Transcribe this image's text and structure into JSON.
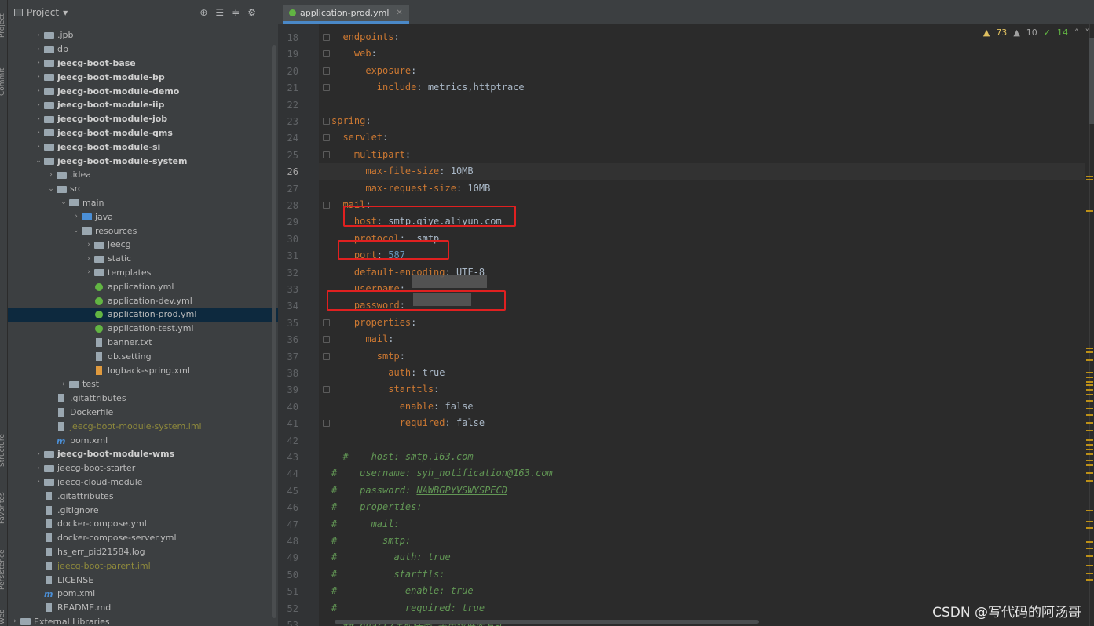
{
  "side_strip": {
    "project": "Project",
    "commit": "Commit",
    "structure": "Structure",
    "favorites": "Favorites",
    "persistence": "Persistence",
    "web": "Web"
  },
  "project_panel": {
    "title": "Project",
    "tree": [
      {
        "label": ".jpb",
        "depth": 1,
        "kind": "folder",
        "arrow": "right",
        "style": ""
      },
      {
        "label": "db",
        "depth": 1,
        "kind": "folder",
        "arrow": "right",
        "style": ""
      },
      {
        "label": "jeecg-boot-base",
        "depth": 1,
        "kind": "folder",
        "arrow": "right",
        "style": "bold"
      },
      {
        "label": "jeecg-boot-module-bp",
        "depth": 1,
        "kind": "folder",
        "arrow": "right",
        "style": "bold"
      },
      {
        "label": "jeecg-boot-module-demo",
        "depth": 1,
        "kind": "folder",
        "arrow": "right",
        "style": "bold"
      },
      {
        "label": "jeecg-boot-module-iip",
        "depth": 1,
        "kind": "folder",
        "arrow": "right",
        "style": "bold"
      },
      {
        "label": "jeecg-boot-module-job",
        "depth": 1,
        "kind": "folder",
        "arrow": "right",
        "style": "bold"
      },
      {
        "label": "jeecg-boot-module-qms",
        "depth": 1,
        "kind": "folder",
        "arrow": "right",
        "style": "bold"
      },
      {
        "label": "jeecg-boot-module-si",
        "depth": 1,
        "kind": "folder",
        "arrow": "right",
        "style": "bold"
      },
      {
        "label": "jeecg-boot-module-system",
        "depth": 1,
        "kind": "folder",
        "arrow": "down",
        "style": "bold"
      },
      {
        "label": ".idea",
        "depth": 2,
        "kind": "folder",
        "arrow": "right",
        "style": ""
      },
      {
        "label": "src",
        "depth": 2,
        "kind": "folder",
        "arrow": "down",
        "style": ""
      },
      {
        "label": "main",
        "depth": 3,
        "kind": "folder",
        "arrow": "down",
        "style": ""
      },
      {
        "label": "java",
        "depth": 4,
        "kind": "folder-blue",
        "arrow": "right",
        "style": ""
      },
      {
        "label": "resources",
        "depth": 4,
        "kind": "folder",
        "arrow": "down",
        "style": ""
      },
      {
        "label": "jeecg",
        "depth": 5,
        "kind": "folder",
        "arrow": "right",
        "style": ""
      },
      {
        "label": "static",
        "depth": 5,
        "kind": "folder",
        "arrow": "right",
        "style": ""
      },
      {
        "label": "templates",
        "depth": 5,
        "kind": "folder",
        "arrow": "right",
        "style": ""
      },
      {
        "label": "application.yml",
        "depth": 5,
        "kind": "yaml",
        "arrow": "",
        "style": ""
      },
      {
        "label": "application-dev.yml",
        "depth": 5,
        "kind": "yaml",
        "arrow": "",
        "style": ""
      },
      {
        "label": "application-prod.yml",
        "depth": 5,
        "kind": "yaml",
        "arrow": "",
        "style": "selected"
      },
      {
        "label": "application-test.yml",
        "depth": 5,
        "kind": "yaml",
        "arrow": "",
        "style": ""
      },
      {
        "label": "banner.txt",
        "depth": 5,
        "kind": "file",
        "arrow": "",
        "style": ""
      },
      {
        "label": "db.setting",
        "depth": 5,
        "kind": "file",
        "arrow": "",
        "style": ""
      },
      {
        "label": "logback-spring.xml",
        "depth": 5,
        "kind": "xml",
        "arrow": "",
        "style": ""
      },
      {
        "label": "test",
        "depth": 3,
        "kind": "folder",
        "arrow": "right",
        "style": ""
      },
      {
        "label": ".gitattributes",
        "depth": 2,
        "kind": "file",
        "arrow": "",
        "style": ""
      },
      {
        "label": "Dockerfile",
        "depth": 2,
        "kind": "file",
        "arrow": "",
        "style": ""
      },
      {
        "label": "jeecg-boot-module-system.iml",
        "depth": 2,
        "kind": "file",
        "arrow": "",
        "style": "olive"
      },
      {
        "label": "pom.xml",
        "depth": 2,
        "kind": "mm",
        "arrow": "",
        "style": ""
      },
      {
        "label": "jeecg-boot-module-wms",
        "depth": 1,
        "kind": "folder",
        "arrow": "right",
        "style": "bold"
      },
      {
        "label": "jeecg-boot-starter",
        "depth": 1,
        "kind": "folder",
        "arrow": "right",
        "style": ""
      },
      {
        "label": "jeecg-cloud-module",
        "depth": 1,
        "kind": "folder",
        "arrow": "right",
        "style": ""
      },
      {
        "label": ".gitattributes",
        "depth": 1,
        "kind": "file",
        "arrow": "",
        "style": ""
      },
      {
        "label": ".gitignore",
        "depth": 1,
        "kind": "file",
        "arrow": "",
        "style": ""
      },
      {
        "label": "docker-compose.yml",
        "depth": 1,
        "kind": "file",
        "arrow": "",
        "style": ""
      },
      {
        "label": "docker-compose-server.yml",
        "depth": 1,
        "kind": "file",
        "arrow": "",
        "style": ""
      },
      {
        "label": "hs_err_pid21584.log",
        "depth": 1,
        "kind": "file",
        "arrow": "",
        "style": ""
      },
      {
        "label": "jeecg-boot-parent.iml",
        "depth": 1,
        "kind": "file",
        "arrow": "",
        "style": "olive"
      },
      {
        "label": "LICENSE",
        "depth": 1,
        "kind": "file",
        "arrow": "",
        "style": ""
      },
      {
        "label": "pom.xml",
        "depth": 1,
        "kind": "mm",
        "arrow": "",
        "style": ""
      },
      {
        "label": "README.md",
        "depth": 1,
        "kind": "file",
        "arrow": "",
        "style": ""
      },
      {
        "label": "External Libraries",
        "depth": 0,
        "kind": "folder",
        "arrow": "right",
        "style": ""
      }
    ]
  },
  "editor": {
    "tab_label": "application-prod.yml",
    "inspections": {
      "warnings": "73",
      "weak_warnings": "10",
      "typos": "14"
    },
    "current_line": 26,
    "lines": [
      {
        "n": "18",
        "parts": [
          [
            "k",
            "  endpoints"
          ],
          [
            "v",
            ":"
          ]
        ]
      },
      {
        "n": "19",
        "parts": [
          [
            "k",
            "    web"
          ],
          [
            "v",
            ":"
          ]
        ]
      },
      {
        "n": "20",
        "parts": [
          [
            "k",
            "      exposure"
          ],
          [
            "v",
            ":"
          ]
        ]
      },
      {
        "n": "21",
        "parts": [
          [
            "k",
            "        include"
          ],
          [
            "v",
            ": metrics,httptrace"
          ]
        ]
      },
      {
        "n": "22",
        "parts": []
      },
      {
        "n": "23",
        "parts": [
          [
            "k",
            "spring"
          ],
          [
            "v",
            ":"
          ]
        ]
      },
      {
        "n": "24",
        "parts": [
          [
            "k",
            "  servlet"
          ],
          [
            "v",
            ":"
          ]
        ]
      },
      {
        "n": "25",
        "parts": [
          [
            "k",
            "    multipart"
          ],
          [
            "v",
            ":"
          ]
        ]
      },
      {
        "n": "26",
        "parts": [
          [
            "k",
            "      max-file-size"
          ],
          [
            "v",
            ": 10MB"
          ]
        ]
      },
      {
        "n": "27",
        "parts": [
          [
            "k",
            "      max-request-size"
          ],
          [
            "v",
            ": 10MB"
          ]
        ]
      },
      {
        "n": "28",
        "parts": [
          [
            "k",
            "  mail"
          ],
          [
            "v",
            ":"
          ]
        ]
      },
      {
        "n": "29",
        "parts": [
          [
            "k",
            "    host"
          ],
          [
            "v",
            ": smtp.qiye.aliyun.com"
          ]
        ]
      },
      {
        "n": "30",
        "parts": [
          [
            "k",
            "    protocol"
          ],
          [
            "v",
            ":  smtp"
          ]
        ]
      },
      {
        "n": "31",
        "parts": [
          [
            "k",
            "    port"
          ],
          [
            "v",
            ": "
          ],
          [
            "n",
            "587"
          ]
        ]
      },
      {
        "n": "32",
        "parts": [
          [
            "k",
            "    default-encoding"
          ],
          [
            "v",
            ": UTF-8"
          ]
        ]
      },
      {
        "n": "33",
        "parts": [
          [
            "k",
            "    username"
          ],
          [
            "v",
            ":"
          ]
        ]
      },
      {
        "n": "34",
        "parts": [
          [
            "k",
            "    password"
          ],
          [
            "v",
            ":"
          ]
        ]
      },
      {
        "n": "35",
        "parts": [
          [
            "k",
            "    properties"
          ],
          [
            "v",
            ":"
          ]
        ]
      },
      {
        "n": "36",
        "parts": [
          [
            "k",
            "      mail"
          ],
          [
            "v",
            ":"
          ]
        ]
      },
      {
        "n": "37",
        "parts": [
          [
            "k",
            "        smtp"
          ],
          [
            "v",
            ":"
          ]
        ]
      },
      {
        "n": "38",
        "parts": [
          [
            "k",
            "          auth"
          ],
          [
            "v",
            ": true"
          ]
        ]
      },
      {
        "n": "39",
        "parts": [
          [
            "k",
            "          starttls"
          ],
          [
            "v",
            ":"
          ]
        ]
      },
      {
        "n": "40",
        "parts": [
          [
            "k",
            "            enable"
          ],
          [
            "v",
            ": false"
          ]
        ]
      },
      {
        "n": "41",
        "parts": [
          [
            "k",
            "            required"
          ],
          [
            "v",
            ": false"
          ]
        ]
      },
      {
        "n": "42",
        "parts": []
      },
      {
        "n": "43",
        "parts": [
          [
            "c",
            "  #    host: smtp.163.com"
          ]
        ]
      },
      {
        "n": "44",
        "parts": [
          [
            "c",
            "#    username: syh_notification@163.com"
          ]
        ]
      },
      {
        "n": "45",
        "parts": [
          [
            "c",
            "#    password: "
          ],
          [
            "cu",
            "NAWBGPYVSWYSPECD"
          ]
        ]
      },
      {
        "n": "46",
        "parts": [
          [
            "c",
            "#    properties:"
          ]
        ]
      },
      {
        "n": "47",
        "parts": [
          [
            "c",
            "#      mail:"
          ]
        ]
      },
      {
        "n": "48",
        "parts": [
          [
            "c",
            "#        smtp:"
          ]
        ]
      },
      {
        "n": "49",
        "parts": [
          [
            "c",
            "#          auth: true"
          ]
        ]
      },
      {
        "n": "50",
        "parts": [
          [
            "c",
            "#          starttls:"
          ]
        ]
      },
      {
        "n": "51",
        "parts": [
          [
            "c",
            "#            enable: true"
          ]
        ]
      },
      {
        "n": "52",
        "parts": [
          [
            "c",
            "#            required: true"
          ]
        ]
      },
      {
        "n": "53",
        "parts": [
          [
            "c",
            "  ## quartz定时任务,采用数据库方式"
          ]
        ]
      }
    ]
  },
  "watermark": "CSDN @写代码的阿汤哥",
  "colors": {
    "accent": "#4a88c7",
    "highlight_box": "#e02020",
    "key": "#cc7832",
    "comment": "#629755",
    "number": "#6897bb"
  }
}
